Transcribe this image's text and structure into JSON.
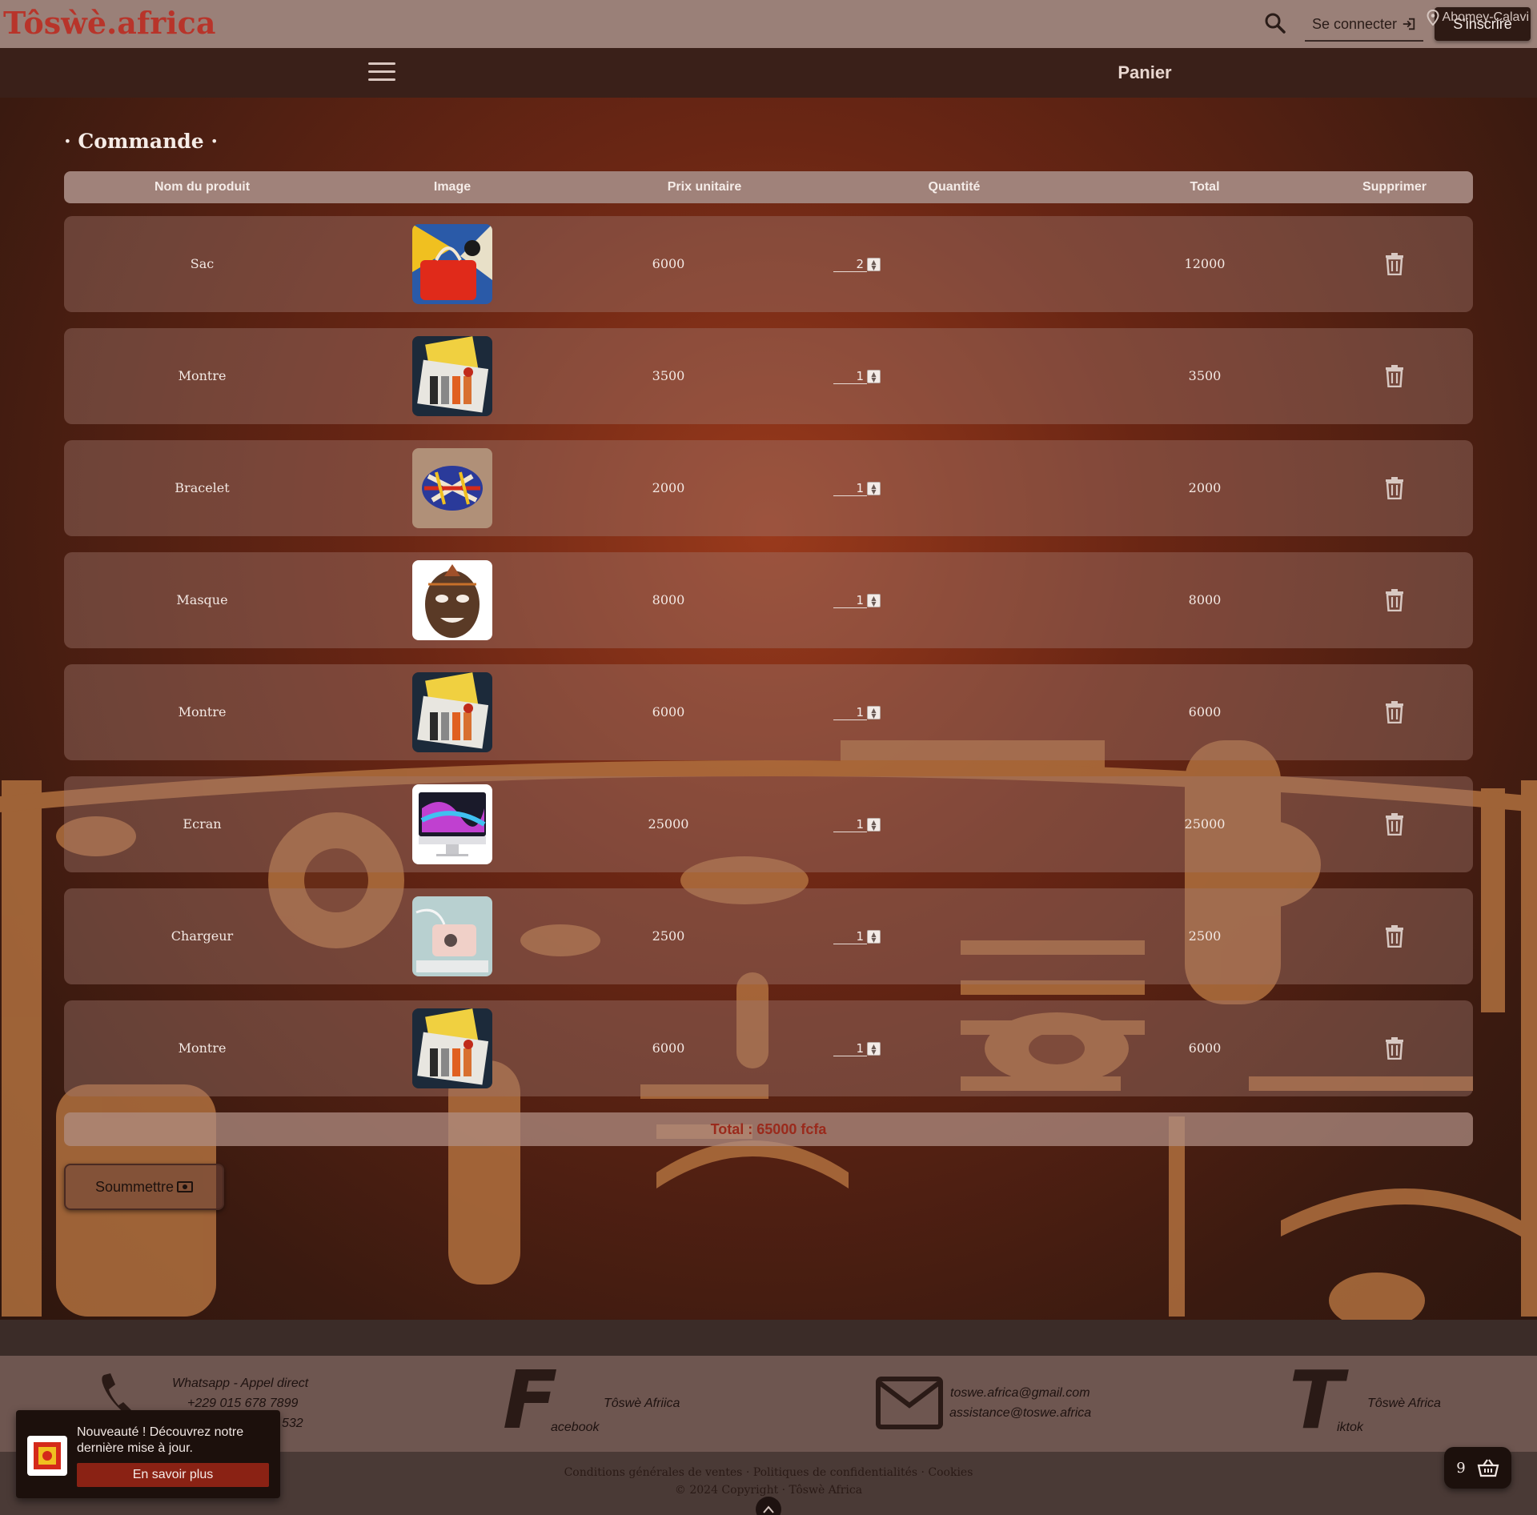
{
  "header": {
    "logo": "Tôsẁè.africa",
    "login_label": "Se connecter",
    "signup_label": "S'inscrire"
  },
  "nav": {
    "page_title": "Panier"
  },
  "order": {
    "title": "· Commande ·",
    "columns": [
      "Nom du produit",
      "Image",
      "Prix unitaire",
      "Quantité",
      "Total",
      "Supprimer"
    ],
    "items": [
      {
        "name": "Sac",
        "image": "sac",
        "price": "6000",
        "qty": "2",
        "total": "12000"
      },
      {
        "name": "Montre",
        "image": "montre",
        "price": "3500",
        "qty": "1",
        "total": "3500"
      },
      {
        "name": "Bracelet",
        "image": "bracelet",
        "price": "2000",
        "qty": "1",
        "total": "2000"
      },
      {
        "name": "Masque",
        "image": "masque",
        "price": "8000",
        "qty": "1",
        "total": "8000"
      },
      {
        "name": "Montre",
        "image": "montre",
        "price": "6000",
        "qty": "1",
        "total": "6000"
      },
      {
        "name": "Ecran",
        "image": "ecran",
        "price": "25000",
        "qty": "1",
        "total": "25000"
      },
      {
        "name": "Chargeur",
        "image": "chargeur",
        "price": "2500",
        "qty": "1",
        "total": "2500"
      },
      {
        "name": "Montre",
        "image": "montre",
        "price": "6000",
        "qty": "1",
        "total": "6000"
      }
    ],
    "grand_total": "Total : 65000 fcfa",
    "submit_label": "Soummettre"
  },
  "footer": {
    "location": "Abomey-Calavi",
    "whatsapp_title": "Whatsapp - Appel direct",
    "phone_1": "+229 015 678 7899",
    "phone_2_partial": "532",
    "facebook_name": "Tôswè Afriica",
    "facebook_label": "acebook",
    "email_1": "toswe.africa@gmail.com",
    "email_2": "assistance@toswe.africa",
    "tiktok_name": "Tôswè Africa",
    "tiktok_label": "iktok",
    "legal_links": "Conditions générales de ventes · Politiques de confidentialités · Cookies",
    "copyright": "© 2024 Copyright · Tôswè Africa"
  },
  "toast": {
    "message": "Nouveauté ! Découvrez notre dernière mise à jour.",
    "button": "En savoir plus"
  },
  "cart_fab": {
    "count": "9"
  },
  "colors": {
    "accent": "#8a2214",
    "header_bg": "#9a8078",
    "nav_bg": "#3a2019",
    "total_text": "#9a2a1c"
  }
}
